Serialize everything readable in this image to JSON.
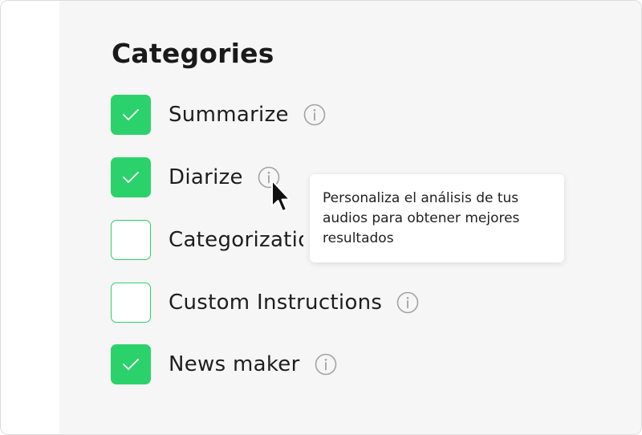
{
  "section": {
    "title": "Categories"
  },
  "categories": [
    {
      "label": "Summarize",
      "checked": true,
      "has_info": true
    },
    {
      "label": "Diarize",
      "checked": true,
      "has_info": true
    },
    {
      "label": "Categorization",
      "checked": false,
      "has_info": false
    },
    {
      "label": "Custom Instructions",
      "checked": false,
      "has_info": true
    },
    {
      "label": "News maker",
      "checked": true,
      "has_info": true
    }
  ],
  "tooltip": {
    "text": "Personaliza el análisis de tus audios para obtener mejores resultados"
  },
  "colors": {
    "accent": "#2bd26b",
    "panel_background": "#f6f6f6",
    "info_icon": "#a3a3a3"
  },
  "icons": {
    "check": "check-icon",
    "info": "info-icon",
    "cursor": "mouse-pointer-icon"
  }
}
